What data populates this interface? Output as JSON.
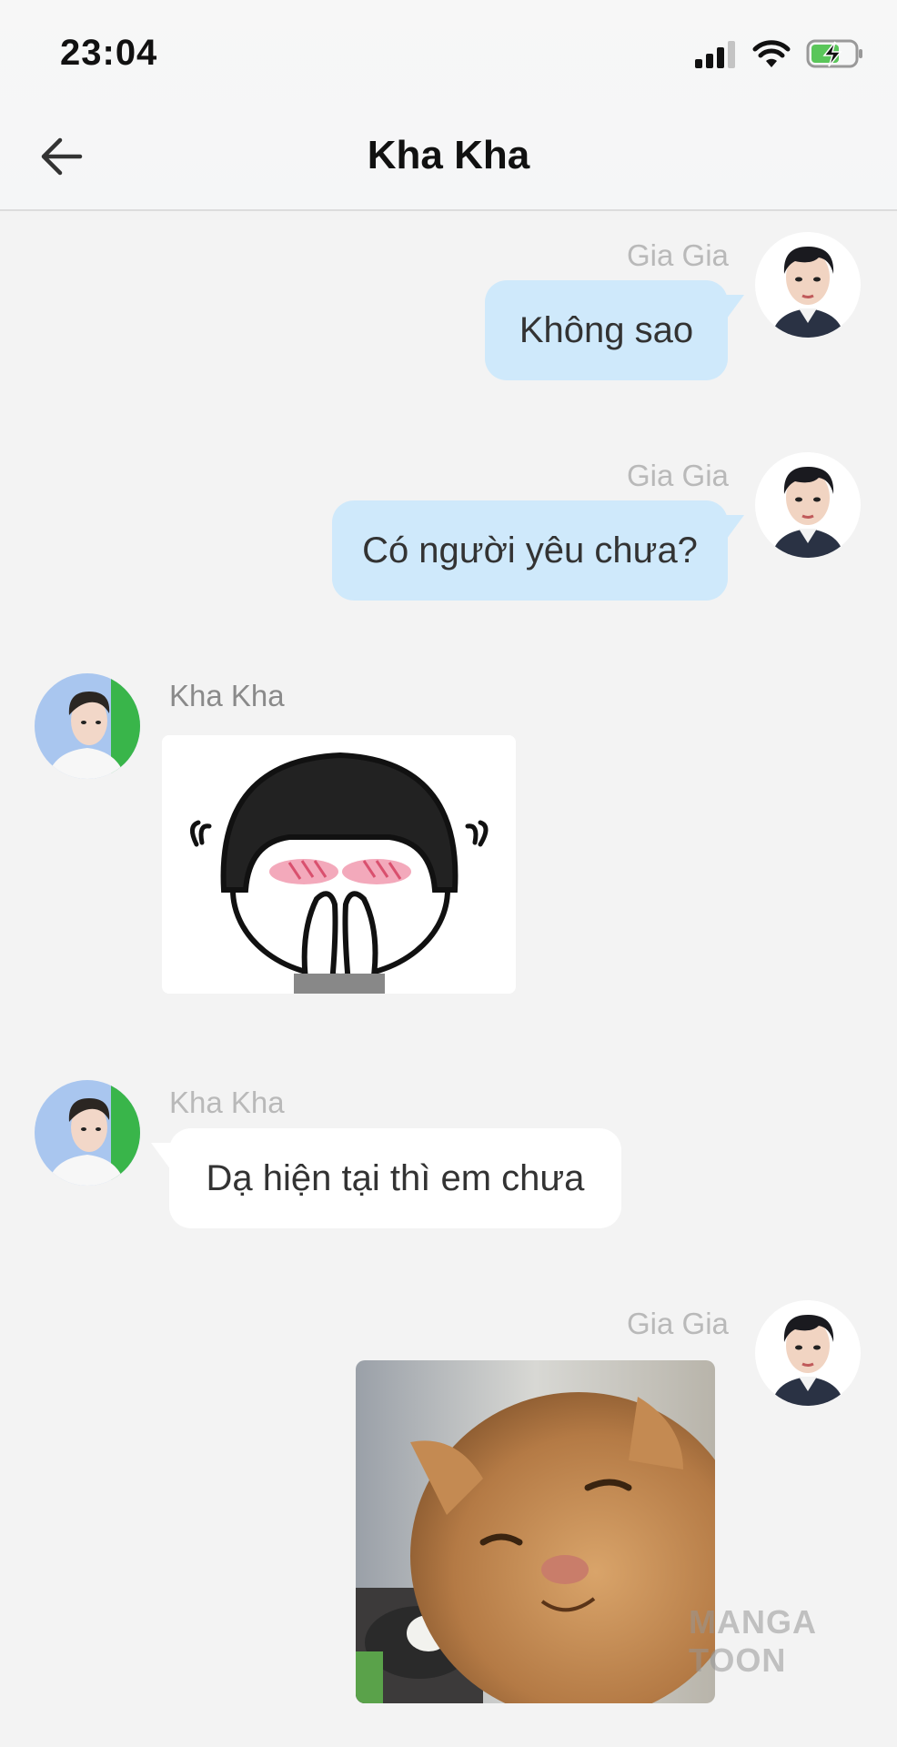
{
  "status_bar": {
    "time": "23:04"
  },
  "header": {
    "title": "Kha Kha"
  },
  "messages": [
    {
      "sender": "Gia Gia",
      "direction": "outgoing",
      "type": "text",
      "text": "Không sao"
    },
    {
      "sender": "Gia Gia",
      "direction": "outgoing",
      "type": "text",
      "text": "Có người yêu chưa?"
    },
    {
      "sender": "Kha Kha",
      "direction": "incoming",
      "type": "sticker"
    },
    {
      "sender": "Kha Kha",
      "direction": "incoming",
      "type": "text",
      "text": "Dạ hiện tại thì em chưa"
    },
    {
      "sender": "Gia Gia",
      "direction": "outgoing",
      "type": "image"
    }
  ],
  "watermark": "MANGA TOON",
  "colors": {
    "outgoing_bubble": "#cfe9fb",
    "incoming_bubble": "#ffffff",
    "background": "#f3f3f3"
  }
}
